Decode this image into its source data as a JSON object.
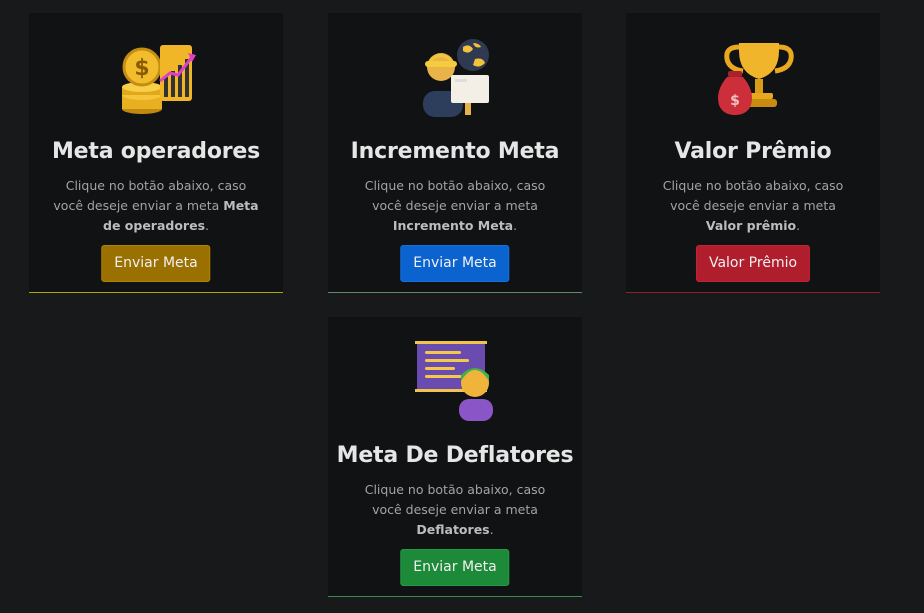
{
  "cards": [
    {
      "title": "Meta operadores",
      "desc_prefix": "Clique no botão abaixo, caso você deseje enviar a meta ",
      "desc_bold": "Meta de operadores",
      "desc_suffix": ".",
      "button": "Enviar Meta",
      "button_color": "#9a7000",
      "line_color": "#b0a600",
      "icon": "money-chart-icon"
    },
    {
      "title": "Incremento Meta",
      "desc_prefix": "Clique no botão abaixo, caso você deseje enviar a meta ",
      "desc_bold": "Incremento Meta",
      "desc_suffix": ".",
      "button": "Enviar Meta",
      "button_color": "#0b63cf",
      "line_color": "#5f8a68",
      "icon": "worker-globe-icon"
    },
    {
      "title": "Valor Prêmio",
      "desc_prefix": "Clique no botão abaixo, caso você deseje enviar a meta ",
      "desc_bold": "Valor prêmio",
      "desc_suffix": ".",
      "button": "Valor Prêmio",
      "button_color": "#b01d2c",
      "line_color": "#8e1f28",
      "icon": "trophy-moneybag-icon"
    },
    {
      "title": "Meta De Deflatores",
      "desc_prefix": "Clique no botão abaixo, caso você deseje enviar a meta ",
      "desc_bold": "Deflatores",
      "desc_suffix": ".",
      "button": "Enviar Meta",
      "button_color": "#1d8a3a",
      "line_color": "#3f8a4a",
      "icon": "presentation-board-icon"
    }
  ]
}
